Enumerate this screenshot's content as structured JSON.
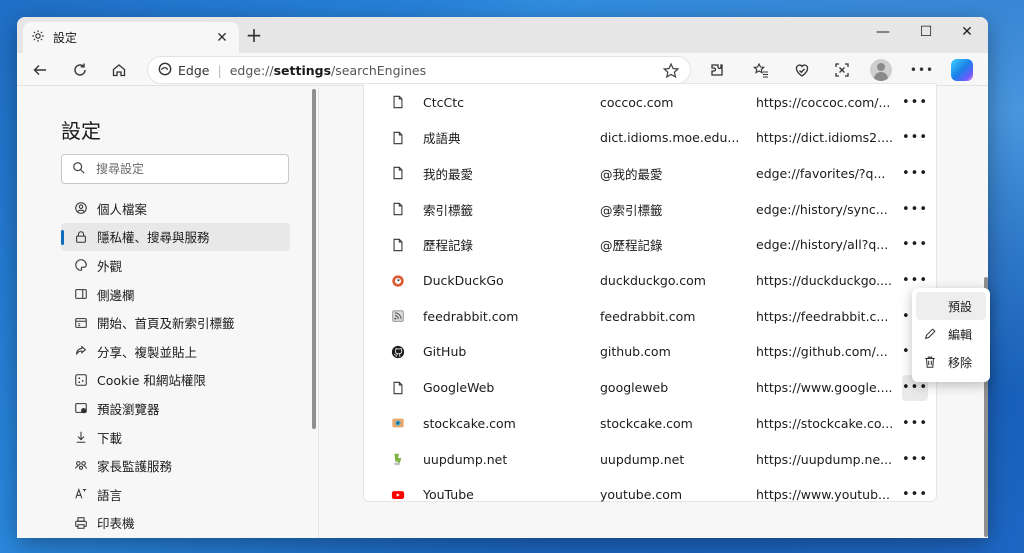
{
  "tab": {
    "title": "設定",
    "new_tab_label": "+"
  },
  "window_controls": {
    "minimize": "—",
    "maximize": "☐",
    "close": "✕"
  },
  "address": {
    "brand": "Edge",
    "url_prefix": "edge://",
    "url_host": "settings",
    "url_path": "/searchEngines"
  },
  "sidebar": {
    "title": "設定",
    "search_placeholder": "搜尋設定",
    "items": [
      {
        "label": "個人檔案",
        "icon": "profile-icon",
        "active": false
      },
      {
        "label": "隱私權、搜尋與服務",
        "icon": "lock-icon",
        "active": true
      },
      {
        "label": "外觀",
        "icon": "appearance-icon",
        "active": false
      },
      {
        "label": "側邊欄",
        "icon": "sidebar-icon",
        "active": false
      },
      {
        "label": "開始、首頁及新索引標籤",
        "icon": "home-tabs-icon",
        "active": false
      },
      {
        "label": "分享、複製並貼上",
        "icon": "share-icon",
        "active": false
      },
      {
        "label": "Cookie 和網站權限",
        "icon": "cookie-icon",
        "active": false
      },
      {
        "label": "預設瀏覽器",
        "icon": "default-browser-icon",
        "active": false
      },
      {
        "label": "下載",
        "icon": "download-icon",
        "active": false
      },
      {
        "label": "家長監護服務",
        "icon": "family-icon",
        "active": false
      },
      {
        "label": "語言",
        "icon": "language-icon",
        "active": false
      },
      {
        "label": "印表機",
        "icon": "printer-icon",
        "active": false
      }
    ]
  },
  "engines": [
    {
      "name": "CtcCtc",
      "keyword": "coccoc.com",
      "url": "https://coccoc.com/...",
      "icon": "page-icon"
    },
    {
      "name": "成語典",
      "keyword": "dict.idioms.moe.edu...",
      "url": "https://dict.idioms2....",
      "icon": "page-icon"
    },
    {
      "name": "我的最愛",
      "keyword": "@我的最愛",
      "url": "edge://favorites/?q...",
      "icon": "page-icon"
    },
    {
      "name": "索引標籤",
      "keyword": "@索引標籤",
      "url": "edge://history/sync...",
      "icon": "page-icon"
    },
    {
      "name": "歷程記錄",
      "keyword": "@歷程記錄",
      "url": "edge://history/all?q...",
      "icon": "page-icon"
    },
    {
      "name": "DuckDuckGo",
      "keyword": "duckduckgo.com",
      "url": "https://duckduckgo....",
      "icon": "duckduckgo-icon"
    },
    {
      "name": "feedrabbit.com",
      "keyword": "feedrabbit.com",
      "url": "https://feedrabbit.c...",
      "icon": "feed-icon"
    },
    {
      "name": "GitHub",
      "keyword": "github.com",
      "url": "https://github.com/...",
      "icon": "github-icon"
    },
    {
      "name": "GoogleWeb",
      "keyword": "googleweb",
      "url": "https://www.google....",
      "icon": "page-icon"
    },
    {
      "name": "stockcake.com",
      "keyword": "stockcake.com",
      "url": "https://stockcake.co...",
      "icon": "stockcake-icon"
    },
    {
      "name": "uupdump.net",
      "keyword": "uupdump.net",
      "url": "https://uupdump.ne...",
      "icon": "uupdump-icon"
    },
    {
      "name": "YouTube",
      "keyword": "youtube.com",
      "url": "https://www.youtub...",
      "icon": "youtube-icon"
    }
  ],
  "more_label": "•••",
  "context_menu": {
    "default_label": "預設",
    "edit_label": "編輯",
    "remove_label": "移除"
  },
  "colors": {
    "accent": "#0f6cbd",
    "youtube": "#ff0000",
    "duckduckgo": "#de5833"
  }
}
